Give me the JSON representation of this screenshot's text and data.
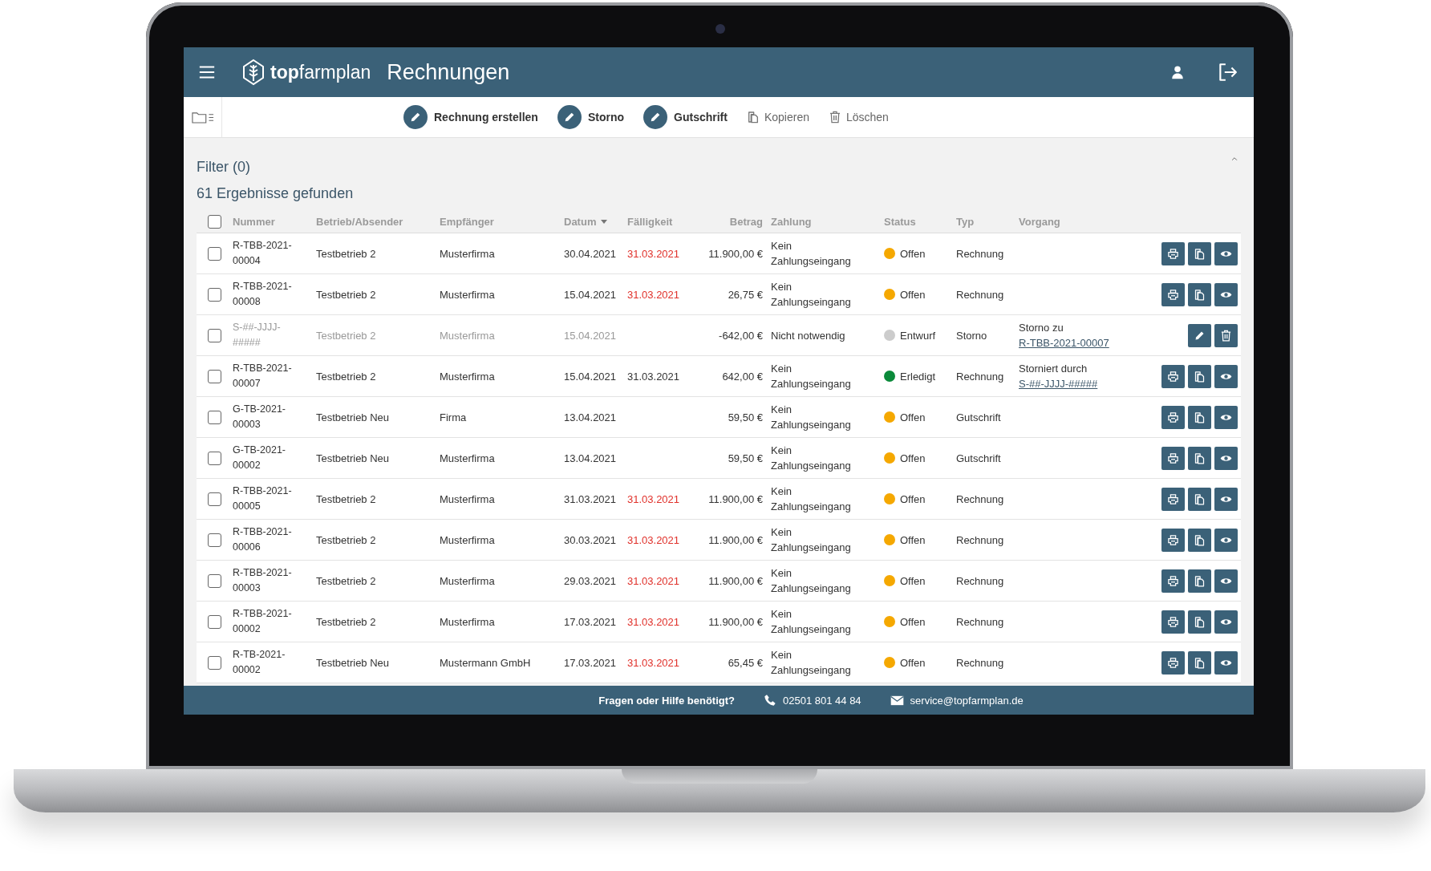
{
  "header": {
    "logo": "**top**farmplan",
    "title": "Rechnungen"
  },
  "toolbar": [
    {
      "kind": "primary",
      "label": "Rechnung erstellen"
    },
    {
      "kind": "primary",
      "label": "Storno"
    },
    {
      "kind": "primary",
      "label": "Gutschrift"
    },
    {
      "kind": "copy",
      "label": "Kopieren"
    },
    {
      "kind": "delete",
      "label": "Löschen"
    }
  ],
  "filter": {
    "label": "Filter (0)",
    "expanded": true
  },
  "results": "61 Ergebnisse gefunden",
  "table": {
    "select_all": {
      "checked": false
    },
    "columns": [
      {
        "label": "Nummer",
        "sorted": false
      },
      {
        "label": "Betrieb/Absender",
        "sorted": false
      },
      {
        "label": "Empfänger",
        "sorted": false
      },
      {
        "label": "Datum",
        "sorted": true
      },
      {
        "label": "Fälligkeit",
        "sorted": false
      },
      {
        "label": "Betrag",
        "sorted": false
      },
      {
        "label": "Zahlung",
        "sorted": false
      },
      {
        "label": "Status",
        "sorted": false
      },
      {
        "label": "Typ",
        "sorted": false
      },
      {
        "label": "Vorgang",
        "sorted": false
      }
    ],
    "rows": [
      {
        "checked": false,
        "muted": false,
        "number": "R-TBB-2021-00004",
        "sender": "Testbetrieb 2",
        "recipient": "Musterfirma",
        "date": "30.04.2021",
        "due": "31.03.2021",
        "overdue": true,
        "amount": "11.900,00 €",
        "payment": "Kein Zahlungseingang",
        "status": "Offen",
        "color": "#f5a800",
        "type": "Rechnung",
        "actions": [
          {
            "kind": "print"
          },
          {
            "kind": "copy"
          },
          {
            "kind": "view"
          }
        ]
      },
      {
        "checked": false,
        "muted": false,
        "number": "R-TBB-2021-00008",
        "sender": "Testbetrieb 2",
        "recipient": "Musterfirma",
        "date": "15.04.2021",
        "due": "31.03.2021",
        "overdue": true,
        "amount": "26,75 €",
        "payment": "Kein Zahlungseingang",
        "status": "Offen",
        "color": "#f5a800",
        "type": "Rechnung",
        "actions": [
          {
            "kind": "print"
          },
          {
            "kind": "copy"
          },
          {
            "kind": "view"
          }
        ]
      },
      {
        "checked": false,
        "muted": true,
        "number": "S-##-JJJJ-#####",
        "sender": "Testbetrieb 2",
        "recipient": "Musterfirma",
        "date": "15.04.2021",
        "amount": "-642,00 €",
        "payment": "Nicht notwendig",
        "status": "Entwurf",
        "color": "#cccccc",
        "type": "Storno",
        "process": {
          "text": "Storno zu",
          "link": "R-TBB-2021-00007"
        },
        "actions": [
          {
            "kind": "edit"
          },
          {
            "kind": "delete"
          }
        ]
      },
      {
        "checked": false,
        "muted": false,
        "number": "R-TBB-2021-00007",
        "sender": "Testbetrieb 2",
        "recipient": "Musterfirma",
        "date": "15.04.2021",
        "due": "31.03.2021",
        "overdue": false,
        "amount": "642,00 €",
        "payment": "Kein Zahlungseingang",
        "status": "Erledigt",
        "color": "#0b8a3a",
        "type": "Rechnung",
        "process": {
          "text": "Storniert durch",
          "link": "S-##-JJJJ-#####"
        },
        "actions": [
          {
            "kind": "print"
          },
          {
            "kind": "copy"
          },
          {
            "kind": "view"
          }
        ]
      },
      {
        "checked": false,
        "muted": false,
        "number": "G-TB-2021-00003",
        "sender": "Testbetrieb Neu",
        "recipient": "Firma",
        "date": "13.04.2021",
        "amount": "59,50 €",
        "payment": "Kein Zahlungseingang",
        "status": "Offen",
        "color": "#f5a800",
        "type": "Gutschrift",
        "actions": [
          {
            "kind": "print"
          },
          {
            "kind": "copy"
          },
          {
            "kind": "view"
          }
        ]
      },
      {
        "checked": false,
        "muted": false,
        "number": "G-TB-2021-00002",
        "sender": "Testbetrieb Neu",
        "recipient": "Musterfirma",
        "date": "13.04.2021",
        "amount": "59,50 €",
        "payment": "Kein Zahlungseingang",
        "status": "Offen",
        "color": "#f5a800",
        "type": "Gutschrift",
        "actions": [
          {
            "kind": "print"
          },
          {
            "kind": "copy"
          },
          {
            "kind": "view"
          }
        ]
      },
      {
        "checked": false,
        "muted": false,
        "number": "R-TBB-2021-00005",
        "sender": "Testbetrieb 2",
        "recipient": "Musterfirma",
        "date": "31.03.2021",
        "due": "31.03.2021",
        "overdue": true,
        "amount": "11.900,00 €",
        "payment": "Kein Zahlungseingang",
        "status": "Offen",
        "color": "#f5a800",
        "type": "Rechnung",
        "actions": [
          {
            "kind": "print"
          },
          {
            "kind": "copy"
          },
          {
            "kind": "view"
          }
        ]
      },
      {
        "checked": false,
        "muted": false,
        "number": "R-TBB-2021-00006",
        "sender": "Testbetrieb 2",
        "recipient": "Musterfirma",
        "date": "30.03.2021",
        "due": "31.03.2021",
        "overdue": true,
        "amount": "11.900,00 €",
        "payment": "Kein Zahlungseingang",
        "status": "Offen",
        "color": "#f5a800",
        "type": "Rechnung",
        "actions": [
          {
            "kind": "print"
          },
          {
            "kind": "copy"
          },
          {
            "kind": "view"
          }
        ]
      },
      {
        "checked": false,
        "muted": false,
        "number": "R-TBB-2021-00003",
        "sender": "Testbetrieb 2",
        "recipient": "Musterfirma",
        "date": "29.03.2021",
        "due": "31.03.2021",
        "overdue": true,
        "amount": "11.900,00 €",
        "payment": "Kein Zahlungseingang",
        "status": "Offen",
        "color": "#f5a800",
        "type": "Rechnung",
        "actions": [
          {
            "kind": "print"
          },
          {
            "kind": "copy"
          },
          {
            "kind": "view"
          }
        ]
      },
      {
        "checked": false,
        "muted": false,
        "number": "R-TBB-2021-00002",
        "sender": "Testbetrieb 2",
        "recipient": "Musterfirma",
        "date": "17.03.2021",
        "due": "31.03.2021",
        "overdue": true,
        "amount": "11.900,00 €",
        "payment": "Kein Zahlungseingang",
        "status": "Offen",
        "color": "#f5a800",
        "type": "Rechnung",
        "actions": [
          {
            "kind": "print"
          },
          {
            "kind": "copy"
          },
          {
            "kind": "view"
          }
        ]
      },
      {
        "checked": false,
        "muted": false,
        "number": "R-TB-2021-00002",
        "sender": "Testbetrieb Neu",
        "recipient": "Mustermann GmbH",
        "date": "17.03.2021",
        "due": "31.03.2021",
        "overdue": true,
        "amount": "65,45 €",
        "payment": "Kein Zahlungseingang",
        "status": "Offen",
        "color": "#f5a800",
        "type": "Rechnung",
        "actions": [
          {
            "kind": "print"
          },
          {
            "kind": "copy"
          },
          {
            "kind": "view"
          }
        ]
      }
    ]
  },
  "footer": {
    "question": "Fragen oder Hilfe benötigt?",
    "phone": "02501 801 44 84",
    "email": "service@topfarmplan.de"
  }
}
